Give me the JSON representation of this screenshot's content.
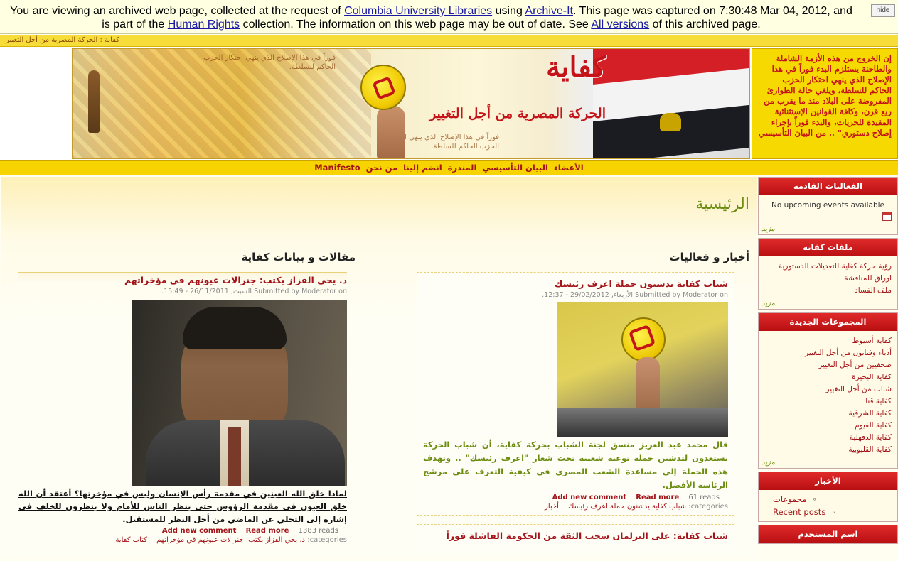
{
  "archive": {
    "t1": "You are viewing an archived web page, collected at the request of ",
    "link1": "Columbia University Libraries",
    "t2": " using ",
    "link2": "Archive-It",
    "t3": ". This page was captured on 7:30:48 Mar 04, 2012, and is part of the ",
    "link3": "Human Rights",
    "t4": " collection. The information on this web page may be out of date. See ",
    "link4": "All versions",
    "t5": " of this archived page.",
    "hide": "hide"
  },
  "breadcrumb": "كفاية : الحركة المصرية من أجل التغيير",
  "banner": {
    "logo": "كفاية",
    "subtitle": "الحركة المصرية من أجل التغيير",
    "faint1": "فوراً في هذا الإصلاح الذي ينهي احتكار الحزب الحاكم للسلطة.",
    "faint2": "فوراً في هذا الإصلاح الذي ينهي احتكار الحزب الحاكم للسلطة.",
    "quote": "إن الخروج من هذه الأزمة الشاملة والطاحنة يستلزم البدء فوراً في هذا الإصلاح الذي ينهي احتكار الحزب الحاكم للسلطة، ويلغي حالة الطوارئ المفروضة على البلاد منذ ما يقرب من ربع قرن، وكافة القوانين الإستثنائية المقيدة للحريات، والبدء فوراً بإجراء إصلاح دستوري\" .. من البيان التأسيسي"
  },
  "nav": [
    "Manifesto",
    "الأعضاء",
    "البيان التأسيسي",
    "المندرة",
    "انضم إلينا",
    "من نحن"
  ],
  "page_title": "الرئيسية",
  "news": {
    "heading": "أخبار و فعاليات",
    "title": "شباب كفاية يدشنون حملة اعرف رئيسك",
    "meta": "Submitted by Moderator on الأربعاء, 29/02/2012 - 12:37.",
    "body": "قال محمد عبد العزيز منسق لجنة الشباب بحركة كفاية، أن شباب الحركة يستعدون لتدشين حملة توعية شعبية تحت شعار \"اعرف رئيسك\" .. وتهدف هذه الحملة إلى مساعدة الشعب المصري في كيفية التعرف على مرشح الرئاسة الأفضل.",
    "reads": "61 reads",
    "read_more": "Read more",
    "add_comment": "Add new comment",
    "terms_label": "categories:",
    "terms": [
      "شباب كفاية يدشنون حملة اعرف رئيسك",
      "أخبار"
    ],
    "next_title": "شباب كفاية: على البرلمان سحب الثقة من الحكومة الفاشلة فوراً"
  },
  "articles": {
    "heading": "مقالات و بيانات كفاية",
    "title": "د. يحي القزاز يكتب: جنرالات عيونهم في مؤخراتهم",
    "meta": "Submitted by Moderator on السبت, 26/11/2011 - 15:49.",
    "body": "لماذا خلق الله العينين في مقدمة رأس الإنسان وليس في مؤخرتها؟ أعتقد أن الله خلق العيون في مقدمة الرؤوس حتى ينظر الناس للأمام ولا ينظرون للخلف في إشارة إلى التخلي عن الماضي من أجل النظر للمستقبل.",
    "reads": "1383 reads",
    "read_more": "Read more",
    "add_comment": "Add new comment",
    "terms_label": "categories:",
    "terms": [
      "د. يحي القزاز يكتب: جنرالات عيونهم في مؤخراتهم",
      "كتاب كفاية"
    ]
  },
  "sidebar": {
    "events": {
      "title": "الفعاليات القادمة",
      "empty": "No upcoming events available",
      "more": "مزيد"
    },
    "files": {
      "title": "ملفات كفاية",
      "items": [
        "رؤية حركة كفاية للتعديلات الدستورية",
        "اوراق للمناقشة",
        "ملف الفساد"
      ],
      "more": "مزيد"
    },
    "groups": {
      "title": "المجموعات الجديدة",
      "items": [
        "كفاية أسيوط",
        "أدباء وفنانون من أجل التغيير",
        "صحفيين من أجل التغيير",
        "كفاية البحيرة",
        "شباب من أجل التغيير",
        "كفاية قنا",
        "كفاية الشرقية",
        "كفاية الفيوم",
        "كفاية الدقهلية",
        "كفاية القليوبية"
      ],
      "more": "مزيد"
    },
    "news": {
      "title": "الأخبار",
      "items": [
        "مجموعات",
        "Recent posts"
      ]
    },
    "login": {
      "title": "اسم المستخدم"
    }
  },
  "colors": {
    "accent_red": "#a3141a",
    "header_red": "#c4141a",
    "green_text": "#6c8c12",
    "yellow": "#f7d400"
  }
}
